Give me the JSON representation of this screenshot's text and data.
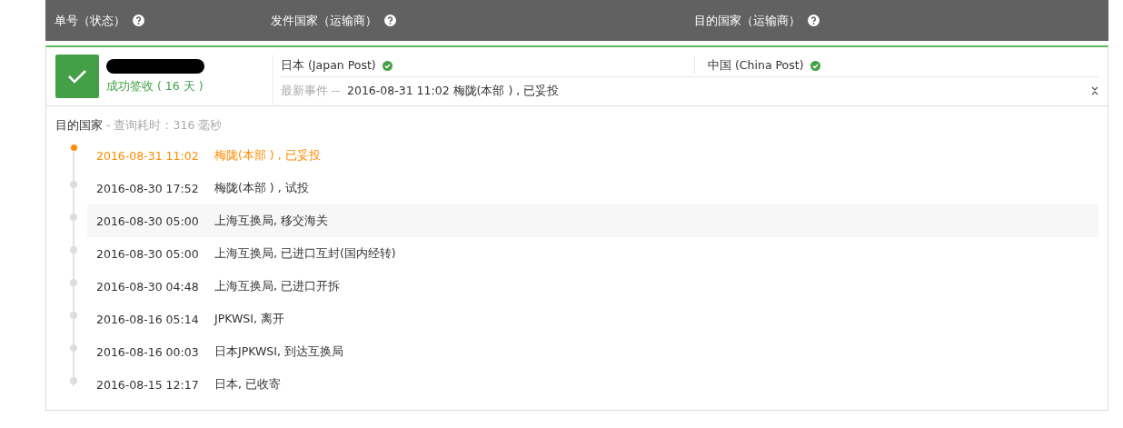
{
  "header": {
    "columns": [
      {
        "label": "单号（状态）"
      },
      {
        "label": "发件国家（运输商）"
      },
      {
        "label": "目的国家（运输商）"
      }
    ]
  },
  "shipment": {
    "delivered": true,
    "status": "成功签收 ( 16 天 )",
    "redacted": true,
    "origin": {
      "name": "日本 (Japan Post)",
      "verified": true
    },
    "destination": {
      "name": "中国 (China Post)",
      "verified": true
    },
    "latest_label": "最新事件 --",
    "latest_event": "2016-08-31 11:02 梅陇(本部 ) , 已妥投"
  },
  "section": {
    "title": "目的国家",
    "note": "- 查询耗时：316 毫秒"
  },
  "events": [
    {
      "time": "2016-08-31 11:02",
      "desc": "梅陇(本部 ) , 已妥投",
      "latest": true,
      "highlighted": false
    },
    {
      "time": "2016-08-30 17:52",
      "desc": "梅陇(本部 ) , 试投",
      "latest": false,
      "highlighted": false
    },
    {
      "time": "2016-08-30 05:00",
      "desc": "上海互换局, 移交海关",
      "latest": false,
      "highlighted": true
    },
    {
      "time": "2016-08-30 05:00",
      "desc": "上海互换局, 已进口互封(国内经转)",
      "latest": false,
      "highlighted": false
    },
    {
      "time": "2016-08-30 04:48",
      "desc": "上海互换局, 已进口开拆",
      "latest": false,
      "highlighted": false
    },
    {
      "time": "2016-08-16 05:14",
      "desc": "JPKWSI, 离开",
      "latest": false,
      "highlighted": false
    },
    {
      "time": "2016-08-16 00:03",
      "desc": "日本JPKWSI, 到达互换局",
      "latest": false,
      "highlighted": false
    },
    {
      "time": "2016-08-15 12:17",
      "desc": "日本, 已收寄",
      "latest": false,
      "highlighted": false
    }
  ]
}
